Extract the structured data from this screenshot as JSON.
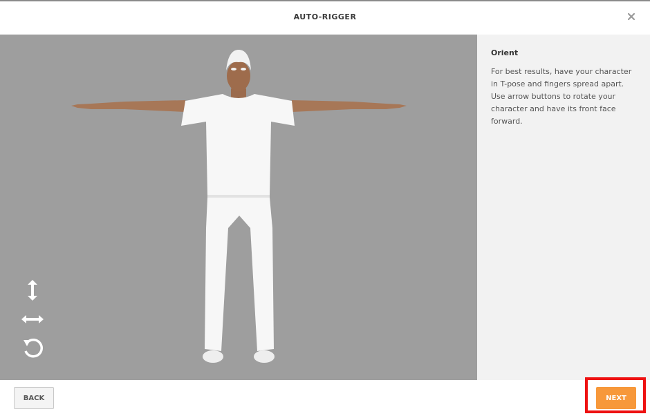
{
  "header": {
    "title": "AUTO-RIGGER",
    "close_icon": "close-icon"
  },
  "viewport": {
    "model": "3d-character-t-pose",
    "tools": [
      {
        "icon": "vertical-move-icon"
      },
      {
        "icon": "horizontal-move-icon"
      },
      {
        "icon": "rotate-icon"
      }
    ]
  },
  "panel": {
    "heading": "Orient",
    "text": "For best results, have your character in T-pose and fingers spread apart. Use arrow buttons to rotate your character and have its front face forward."
  },
  "footer": {
    "back_label": "BACK",
    "next_label": "NEXT"
  },
  "colors": {
    "viewport_bg": "#9e9e9e",
    "panel_bg": "#f2f2f2",
    "next_button": "#f7983a",
    "highlight": "#ee1111"
  }
}
